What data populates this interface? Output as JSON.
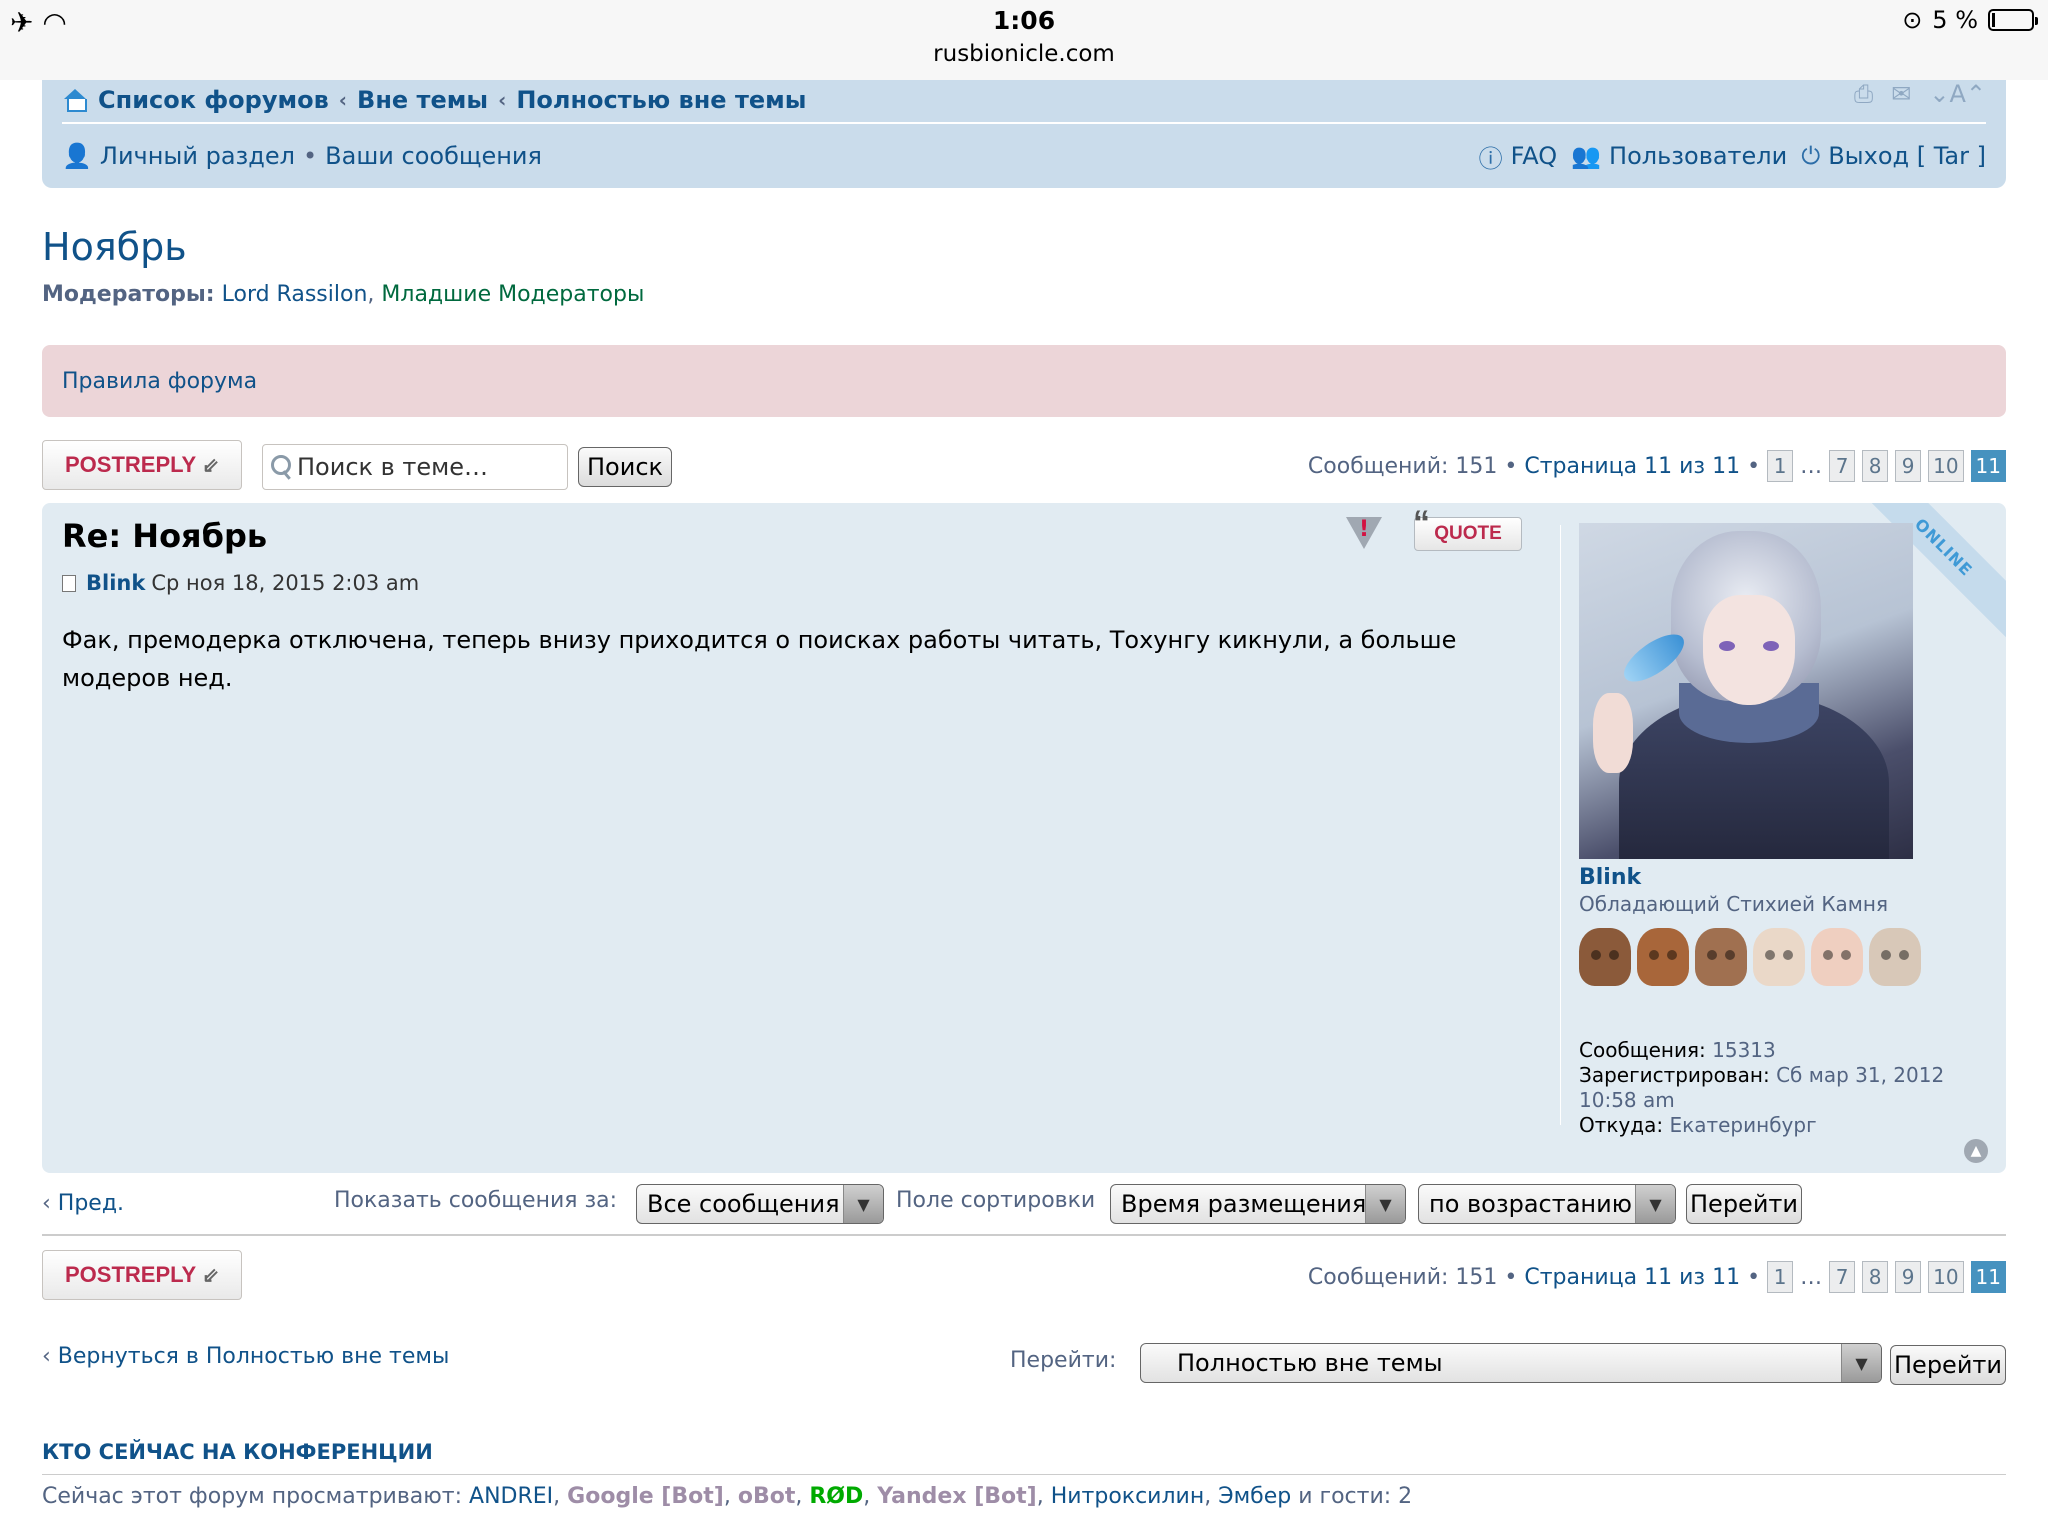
{
  "status": {
    "time": "1:06",
    "url": "rusbionicle.com",
    "battery": "5 %"
  },
  "nav": {
    "breadcrumbs": [
      "Список форумов",
      "Вне темы",
      "Полностью вне темы"
    ],
    "left_links": [
      "Личный раздел",
      "Ваши сообщения"
    ],
    "right_links": {
      "faq": "FAQ",
      "users": "Пользователи",
      "logout": "Выход [ Tar ]"
    }
  },
  "topic": {
    "title": "Ноябрь",
    "moderators_label": "Модераторы:",
    "moderators": [
      "Lord Rassilon",
      "Младшие Модераторы"
    ],
    "rules": "Правила форума"
  },
  "actions": {
    "post_reply": "POSTREPLY",
    "search_placeholder": "Поиск в теме…",
    "search_button": "Поиск",
    "messages_count": "Сообщений: 151",
    "page_info": "Страница 11 из 11",
    "pages": [
      "1",
      "…",
      "7",
      "8",
      "9",
      "10",
      "11"
    ],
    "active_page": "11"
  },
  "post": {
    "title": "Re: Ноябрь",
    "author": "Blink",
    "date": "Ср ноя 18, 2015 2:03 am",
    "body": "Фак, премодерка отключена, теперь внизу приходится о поисках работы читать, Тохунгу кикнули, а больше модеров нед.",
    "quote_label": "QUOTE",
    "report_label": "!",
    "online_label": "ONLINE"
  },
  "profile": {
    "name": "Blink",
    "rank": "Обладающий Стихией Камня",
    "posts_label": "Сообщения:",
    "posts_value": "15313",
    "registered_label": "Зарегистрирован:",
    "registered_value": "Сб мар 31, 2012 10:58 am",
    "from_label": "Откуда:",
    "from_value": "Екатеринбург",
    "mask_colors": [
      "#8b5a3a",
      "#a8663a",
      "#a07050",
      "#ead8c8",
      "#efcfc0",
      "#d8c8b8"
    ]
  },
  "sort": {
    "prev": "Пред.",
    "show_label": "Показать сообщения за:",
    "show_value": "Все сообщения",
    "sort_label": "Поле сортировки",
    "sort_value": "Время размещения",
    "order_value": "по возрастанию",
    "go": "Перейти"
  },
  "footer": {
    "back": "Вернуться в Полностью вне темы",
    "jump_label": "Перейти:",
    "jump_value": "Полностью вне темы",
    "jump_button": "Перейти",
    "who_title": "КТО СЕЙЧАС НА КОНФЕРЕНЦИИ",
    "who_prefix": "Сейчас этот форум просматривают:",
    "users": [
      "ANDREI",
      "Google [Bot]",
      "oBot",
      "RØD",
      "Yandex [Bot]",
      "Нитроксилин",
      "Эмбер"
    ],
    "guests": "и гости: 2"
  }
}
